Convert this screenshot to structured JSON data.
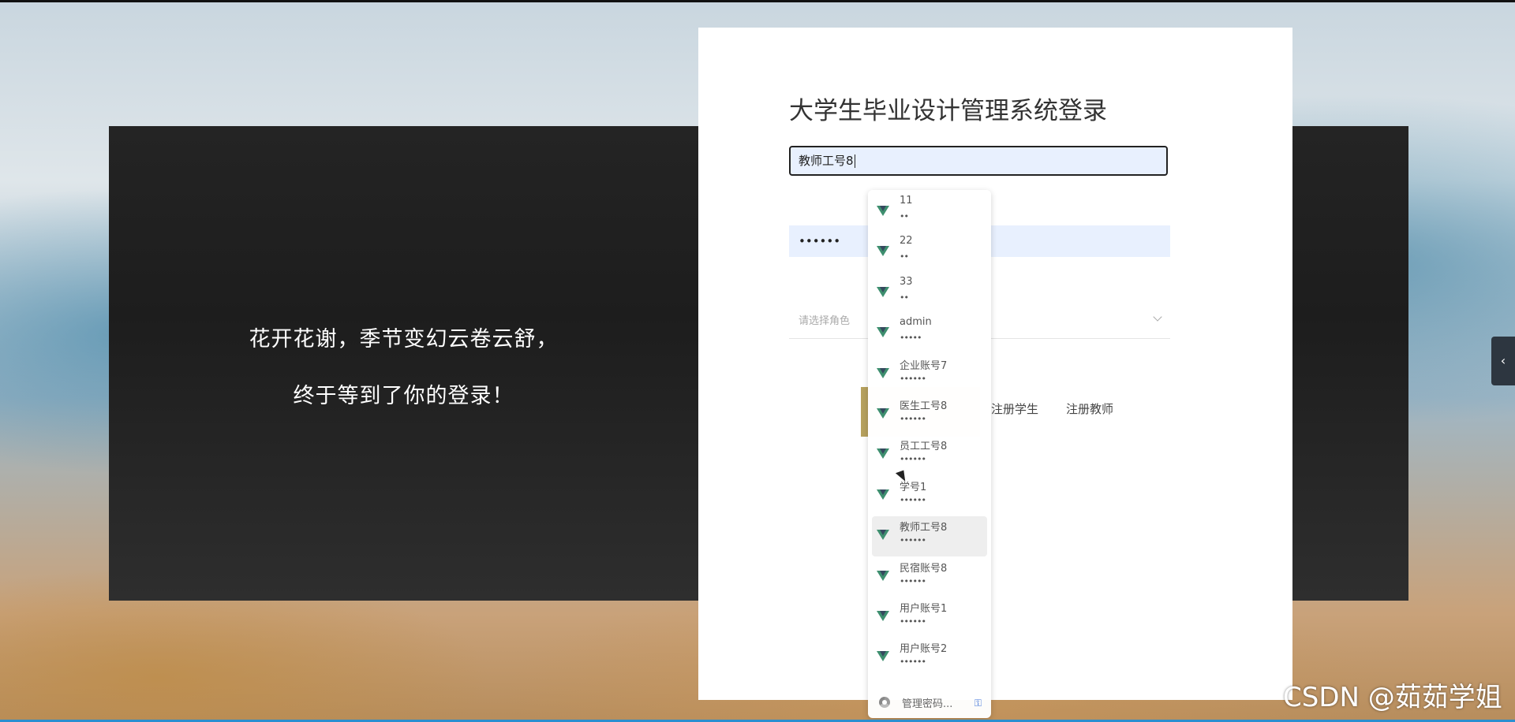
{
  "slogan": {
    "line1": "花开花谢，季节变幻云卷云舒，",
    "line2": "终于等到了你的登录！"
  },
  "login": {
    "title": "大学生毕业设计管理系统登录",
    "username_value": "教师工号8",
    "password_value": "••••••",
    "role_placeholder": "请选择角色",
    "register_student": "注册学生",
    "register_teacher": "注册教师"
  },
  "autofill": {
    "items": [
      {
        "name": "11",
        "mask": "••"
      },
      {
        "name": "22",
        "mask": "••"
      },
      {
        "name": "33",
        "mask": "••"
      },
      {
        "name": "admin",
        "mask": "•••••"
      },
      {
        "name": "企业账号7",
        "mask": "••••••"
      },
      {
        "name": "医生工号8",
        "mask": "••••••"
      },
      {
        "name": "员工工号8",
        "mask": "••••••"
      },
      {
        "name": "学号1",
        "mask": "••••••"
      },
      {
        "name": "教师工号8",
        "mask": "••••••"
      },
      {
        "name": "民宿账号8",
        "mask": "••••••"
      },
      {
        "name": "用户账号1",
        "mask": "••••••"
      },
      {
        "name": "用户账号2",
        "mask": "••••••"
      }
    ],
    "highlighted_index": 8,
    "manage_label": "管理密码..."
  },
  "side_tab_icon": "chevron-left-icon",
  "watermark": "CSDN @茹茹学姐",
  "colors": {
    "accent_vue_green": "#3e8f6f",
    "field_autofill_bg": "#e8f0fe"
  }
}
